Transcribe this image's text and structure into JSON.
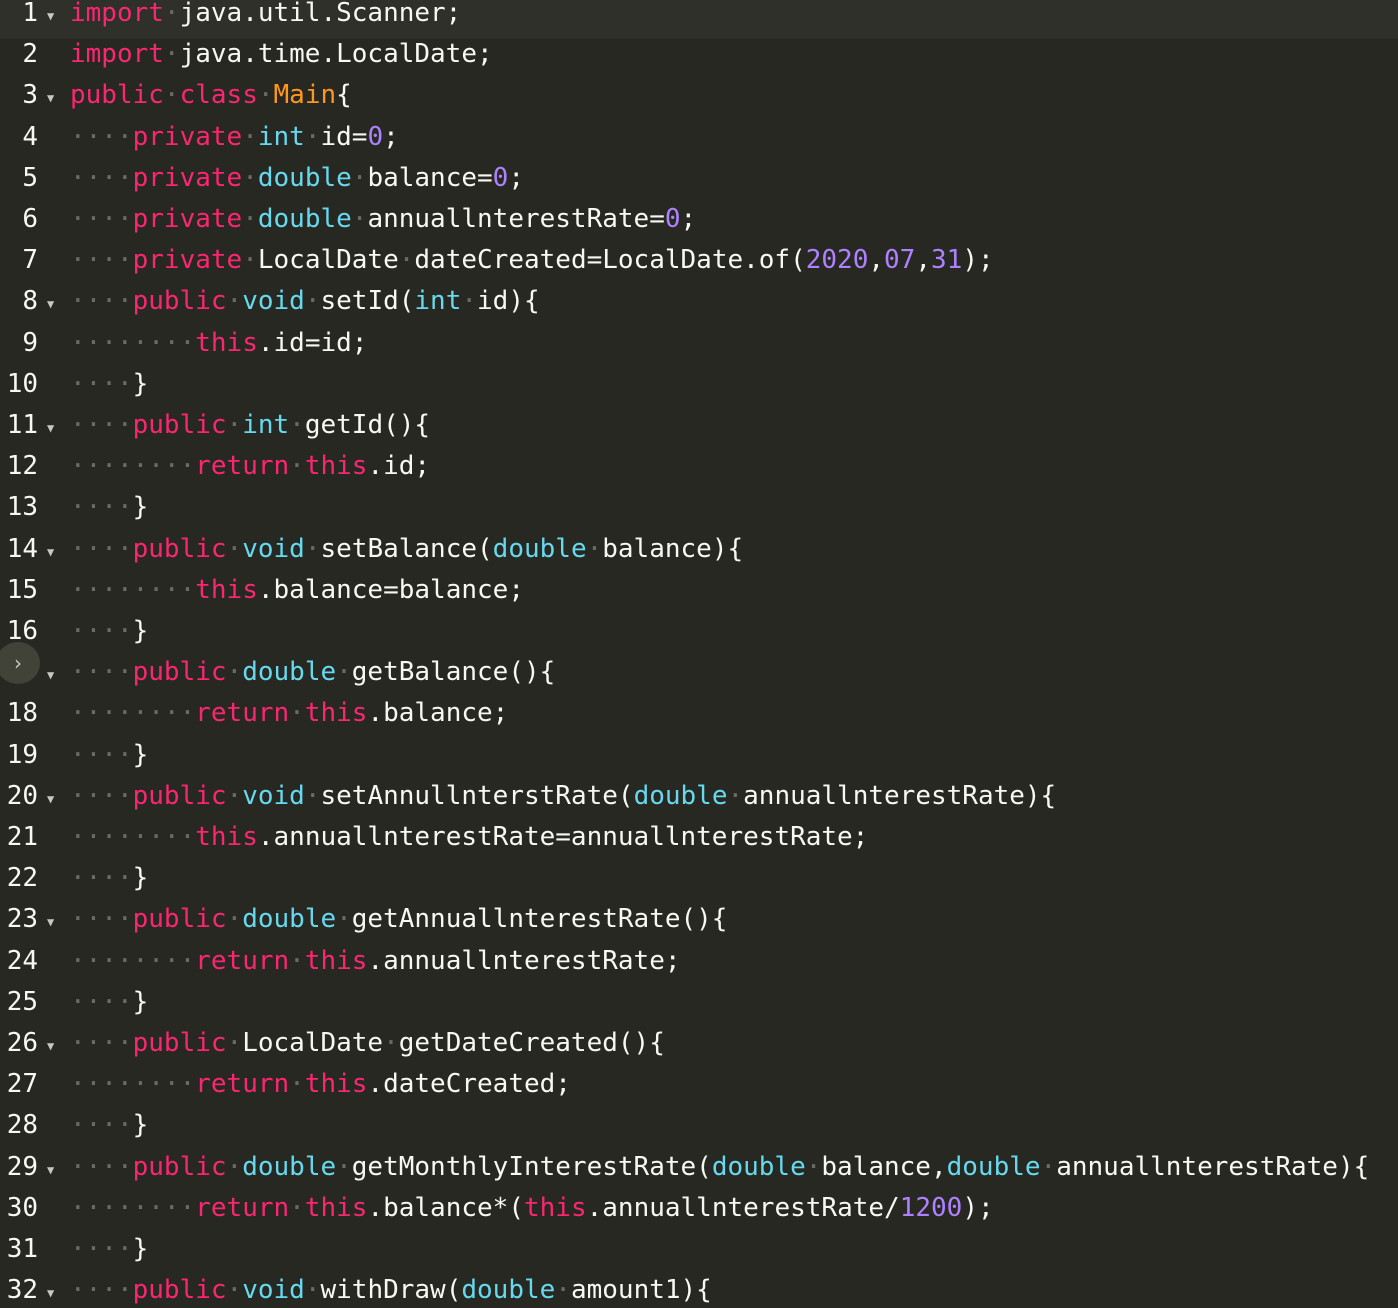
{
  "editor": {
    "language": "java",
    "fold_toggle_icon": "chevron-right-icon",
    "lines": [
      {
        "num": "1",
        "fold": true,
        "active": true,
        "tokens": [
          [
            "kw",
            "import"
          ],
          [
            "ws",
            "·"
          ],
          [
            "plain",
            "java.util.Scanner;"
          ]
        ]
      },
      {
        "num": "2",
        "fold": false,
        "tokens": [
          [
            "kw",
            "import"
          ],
          [
            "ws",
            "·"
          ],
          [
            "plain",
            "java.time.LocalDate;"
          ]
        ]
      },
      {
        "num": "3",
        "fold": true,
        "tokens": [
          [
            "kw",
            "public"
          ],
          [
            "ws",
            "·"
          ],
          [
            "kw",
            "class"
          ],
          [
            "ws",
            "·"
          ],
          [
            "cls",
            "Main"
          ],
          [
            "plain",
            "{"
          ]
        ]
      },
      {
        "num": "4",
        "fold": false,
        "tokens": [
          [
            "ws",
            "····"
          ],
          [
            "kw",
            "private"
          ],
          [
            "ws",
            "·"
          ],
          [
            "type",
            "int"
          ],
          [
            "ws",
            "·"
          ],
          [
            "plain",
            "id="
          ],
          [
            "num",
            "0"
          ],
          [
            "plain",
            ";"
          ]
        ]
      },
      {
        "num": "5",
        "fold": false,
        "tokens": [
          [
            "ws",
            "····"
          ],
          [
            "kw",
            "private"
          ],
          [
            "ws",
            "·"
          ],
          [
            "type",
            "double"
          ],
          [
            "ws",
            "·"
          ],
          [
            "plain",
            "balance="
          ],
          [
            "num",
            "0"
          ],
          [
            "plain",
            ";"
          ]
        ]
      },
      {
        "num": "6",
        "fold": false,
        "tokens": [
          [
            "ws",
            "····"
          ],
          [
            "kw",
            "private"
          ],
          [
            "ws",
            "·"
          ],
          [
            "type",
            "double"
          ],
          [
            "ws",
            "·"
          ],
          [
            "plain",
            "annuallnterestRate="
          ],
          [
            "num",
            "0"
          ],
          [
            "plain",
            ";"
          ]
        ]
      },
      {
        "num": "7",
        "fold": false,
        "tokens": [
          [
            "ws",
            "····"
          ],
          [
            "kw",
            "private"
          ],
          [
            "ws",
            "·"
          ],
          [
            "plain",
            "LocalDate"
          ],
          [
            "ws",
            "·"
          ],
          [
            "plain",
            "dateCreated=LocalDate.of("
          ],
          [
            "num",
            "2020"
          ],
          [
            "plain",
            ","
          ],
          [
            "num",
            "07"
          ],
          [
            "plain",
            ","
          ],
          [
            "num",
            "31"
          ],
          [
            "plain",
            ");"
          ]
        ]
      },
      {
        "num": "8",
        "fold": true,
        "tokens": [
          [
            "ws",
            "····"
          ],
          [
            "kw",
            "public"
          ],
          [
            "ws",
            "·"
          ],
          [
            "type",
            "void"
          ],
          [
            "ws",
            "·"
          ],
          [
            "plain",
            "setId("
          ],
          [
            "type",
            "int"
          ],
          [
            "ws",
            "·"
          ],
          [
            "plain",
            "id){"
          ]
        ]
      },
      {
        "num": "9",
        "fold": false,
        "tokens": [
          [
            "ws",
            "········"
          ],
          [
            "kw",
            "this"
          ],
          [
            "plain",
            ".id=id;"
          ]
        ]
      },
      {
        "num": "10",
        "fold": false,
        "tokens": [
          [
            "ws",
            "····"
          ],
          [
            "plain",
            "}"
          ]
        ]
      },
      {
        "num": "11",
        "fold": true,
        "tokens": [
          [
            "ws",
            "····"
          ],
          [
            "kw",
            "public"
          ],
          [
            "ws",
            "·"
          ],
          [
            "type",
            "int"
          ],
          [
            "ws",
            "·"
          ],
          [
            "plain",
            "getId(){"
          ]
        ]
      },
      {
        "num": "12",
        "fold": false,
        "tokens": [
          [
            "ws",
            "········"
          ],
          [
            "kw",
            "return"
          ],
          [
            "ws",
            "·"
          ],
          [
            "kw",
            "this"
          ],
          [
            "plain",
            ".id;"
          ]
        ]
      },
      {
        "num": "13",
        "fold": false,
        "tokens": [
          [
            "ws",
            "····"
          ],
          [
            "plain",
            "}"
          ]
        ]
      },
      {
        "num": "14",
        "fold": true,
        "tokens": [
          [
            "ws",
            "····"
          ],
          [
            "kw",
            "public"
          ],
          [
            "ws",
            "·"
          ],
          [
            "type",
            "void"
          ],
          [
            "ws",
            "·"
          ],
          [
            "plain",
            "setBalance("
          ],
          [
            "type",
            "double"
          ],
          [
            "ws",
            "·"
          ],
          [
            "plain",
            "balance){"
          ]
        ]
      },
      {
        "num": "15",
        "fold": false,
        "tokens": [
          [
            "ws",
            "········"
          ],
          [
            "kw",
            "this"
          ],
          [
            "plain",
            ".balance=balance;"
          ]
        ]
      },
      {
        "num": "16",
        "fold": false,
        "tokens": [
          [
            "ws",
            "····"
          ],
          [
            "plain",
            "}"
          ]
        ]
      },
      {
        "num": "",
        "fold": true,
        "tokens": [
          [
            "ws",
            "····"
          ],
          [
            "kw",
            "public"
          ],
          [
            "ws",
            "·"
          ],
          [
            "type",
            "double"
          ],
          [
            "ws",
            "·"
          ],
          [
            "plain",
            "getBalance(){"
          ]
        ]
      },
      {
        "num": "18",
        "fold": false,
        "tokens": [
          [
            "ws",
            "········"
          ],
          [
            "kw",
            "return"
          ],
          [
            "ws",
            "·"
          ],
          [
            "kw",
            "this"
          ],
          [
            "plain",
            ".balance;"
          ]
        ]
      },
      {
        "num": "19",
        "fold": false,
        "tokens": [
          [
            "ws",
            "····"
          ],
          [
            "plain",
            "}"
          ]
        ]
      },
      {
        "num": "20",
        "fold": true,
        "tokens": [
          [
            "ws",
            "····"
          ],
          [
            "kw",
            "public"
          ],
          [
            "ws",
            "·"
          ],
          [
            "type",
            "void"
          ],
          [
            "ws",
            "·"
          ],
          [
            "plain",
            "setAnnullnterstRate("
          ],
          [
            "type",
            "double"
          ],
          [
            "ws",
            "·"
          ],
          [
            "plain",
            "annuallnterestRate){"
          ]
        ]
      },
      {
        "num": "21",
        "fold": false,
        "tokens": [
          [
            "ws",
            "········"
          ],
          [
            "kw",
            "this"
          ],
          [
            "plain",
            ".annuallnterestRate=annuallnterestRate;"
          ]
        ]
      },
      {
        "num": "22",
        "fold": false,
        "tokens": [
          [
            "ws",
            "····"
          ],
          [
            "plain",
            "}"
          ]
        ]
      },
      {
        "num": "23",
        "fold": true,
        "tokens": [
          [
            "ws",
            "····"
          ],
          [
            "kw",
            "public"
          ],
          [
            "ws",
            "·"
          ],
          [
            "type",
            "double"
          ],
          [
            "ws",
            "·"
          ],
          [
            "plain",
            "getAnnuallnterestRate(){"
          ]
        ]
      },
      {
        "num": "24",
        "fold": false,
        "tokens": [
          [
            "ws",
            "········"
          ],
          [
            "kw",
            "return"
          ],
          [
            "ws",
            "·"
          ],
          [
            "kw",
            "this"
          ],
          [
            "plain",
            ".annuallnterestRate;"
          ]
        ]
      },
      {
        "num": "25",
        "fold": false,
        "tokens": [
          [
            "ws",
            "····"
          ],
          [
            "plain",
            "}"
          ]
        ]
      },
      {
        "num": "26",
        "fold": true,
        "tokens": [
          [
            "ws",
            "····"
          ],
          [
            "kw",
            "public"
          ],
          [
            "ws",
            "·"
          ],
          [
            "plain",
            "LocalDate"
          ],
          [
            "ws",
            "·"
          ],
          [
            "plain",
            "getDateCreated(){"
          ]
        ]
      },
      {
        "num": "27",
        "fold": false,
        "tokens": [
          [
            "ws",
            "········"
          ],
          [
            "kw",
            "return"
          ],
          [
            "ws",
            "·"
          ],
          [
            "kw",
            "this"
          ],
          [
            "plain",
            ".dateCreated;"
          ]
        ]
      },
      {
        "num": "28",
        "fold": false,
        "tokens": [
          [
            "ws",
            "····"
          ],
          [
            "plain",
            "}"
          ]
        ]
      },
      {
        "num": "29",
        "fold": true,
        "tokens": [
          [
            "ws",
            "····"
          ],
          [
            "kw",
            "public"
          ],
          [
            "ws",
            "·"
          ],
          [
            "type",
            "double"
          ],
          [
            "ws",
            "·"
          ],
          [
            "plain",
            "getMonthlyInterestRate("
          ],
          [
            "type",
            "double"
          ],
          [
            "ws",
            "·"
          ],
          [
            "plain",
            "balance,"
          ],
          [
            "type",
            "double"
          ],
          [
            "ws",
            "·"
          ],
          [
            "plain",
            "annuallnterestRate){"
          ]
        ]
      },
      {
        "num": "30",
        "fold": false,
        "tokens": [
          [
            "ws",
            "········"
          ],
          [
            "kw",
            "return"
          ],
          [
            "ws",
            "·"
          ],
          [
            "kw",
            "this"
          ],
          [
            "plain",
            ".balance*("
          ],
          [
            "kw",
            "this"
          ],
          [
            "plain",
            ".annuallnterestRate/"
          ],
          [
            "num",
            "1200"
          ],
          [
            "plain",
            ");"
          ]
        ]
      },
      {
        "num": "31",
        "fold": false,
        "tokens": [
          [
            "ws",
            "····"
          ],
          [
            "plain",
            "}"
          ]
        ]
      },
      {
        "num": "32",
        "fold": true,
        "tokens": [
          [
            "ws",
            "····"
          ],
          [
            "kw",
            "public"
          ],
          [
            "ws",
            "·"
          ],
          [
            "type",
            "void"
          ],
          [
            "ws",
            "·"
          ],
          [
            "plain",
            "withDraw("
          ],
          [
            "type",
            "double"
          ],
          [
            "ws",
            "·"
          ],
          [
            "plain",
            "amount1){"
          ]
        ]
      }
    ]
  }
}
